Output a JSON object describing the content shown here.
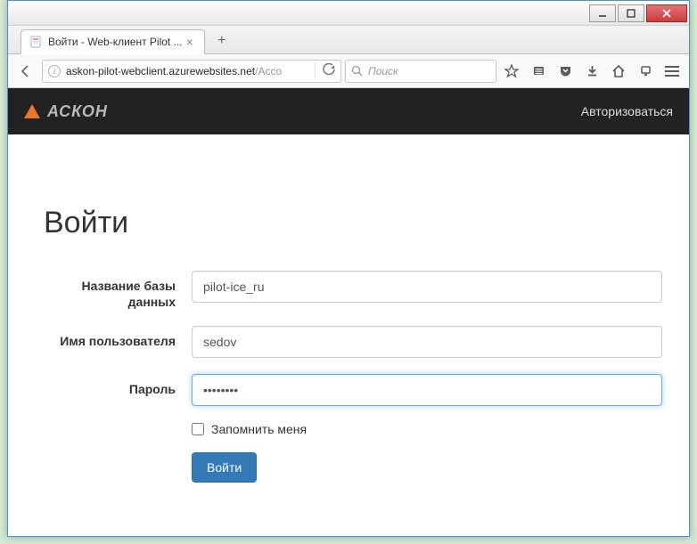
{
  "window": {
    "tab_title": "Войти - Web-клиент Pilot ...",
    "url_host": "askon-pilot-webclient.azurewebsites.net",
    "url_path": "/Acco",
    "search_placeholder": "Поиск"
  },
  "app_header": {
    "logo_text": "аскон",
    "auth_link": "Авторизоваться"
  },
  "login": {
    "title": "Войти",
    "labels": {
      "database": "Название базы данных",
      "username": "Имя пользователя",
      "password": "Пароль",
      "remember": "Запомнить меня"
    },
    "values": {
      "database": "pilot-ice_ru",
      "username": "sedov",
      "password": "••••••••"
    },
    "submit": "Войти"
  }
}
